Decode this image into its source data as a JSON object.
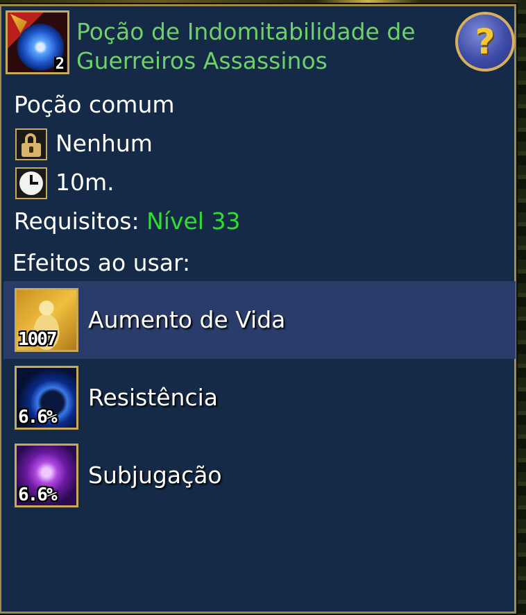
{
  "item": {
    "title": "Poção de Indomitabilidade de Guerreiros Assassinos",
    "count": "2",
    "icon": "potion-icon"
  },
  "help": {
    "label": "?"
  },
  "details": {
    "type": "Poção comum",
    "binding": "Nenhum",
    "duration": "10m.",
    "requirements_label": "Requisitos:",
    "requirements_value": "Nível 33"
  },
  "effects": {
    "heading": "Efeitos ao usar:",
    "items": [
      {
        "label": "Aumento de Vida",
        "value": "1007",
        "icon": "life-boost-icon",
        "selected": true
      },
      {
        "label": "Resistência",
        "value": "6.6%",
        "icon": "resistance-icon",
        "selected": false
      },
      {
        "label": "Subjugação",
        "value": "6.6%",
        "icon": "subjugation-icon",
        "selected": false
      }
    ]
  },
  "colors": {
    "panel_bg": "#152a46",
    "border": "#a08a4c",
    "title_green": "#6fd06b",
    "requirement_green": "#2ee02e",
    "selected_row": "#2a3d6a"
  }
}
